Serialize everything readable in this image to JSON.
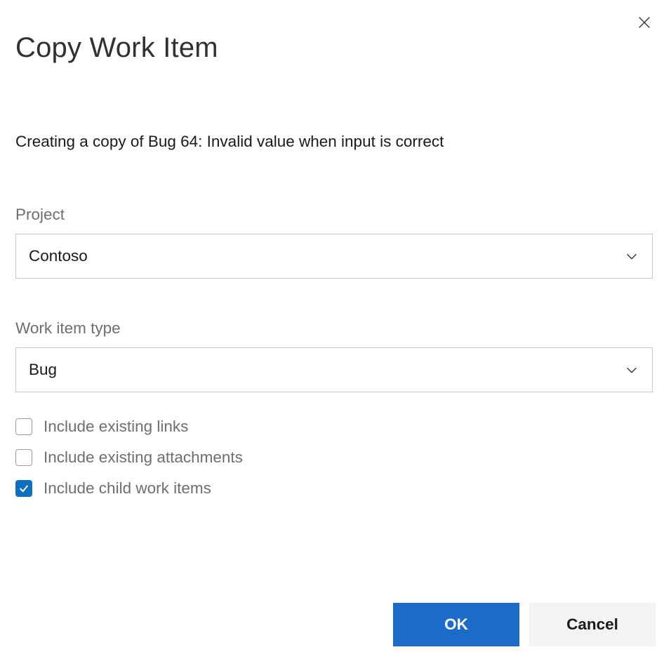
{
  "dialog": {
    "title": "Copy Work Item",
    "description": "Creating a copy of Bug 64: Invalid value when input is correct"
  },
  "fields": {
    "project": {
      "label": "Project",
      "value": "Contoso"
    },
    "workItemType": {
      "label": "Work item type",
      "value": "Bug"
    }
  },
  "checkboxes": {
    "includeLinks": {
      "label": "Include existing links",
      "checked": false
    },
    "includeAttachments": {
      "label": "Include existing attachments",
      "checked": false
    },
    "includeChildItems": {
      "label": "Include child work items",
      "checked": true
    }
  },
  "buttons": {
    "ok": "OK",
    "cancel": "Cancel"
  }
}
